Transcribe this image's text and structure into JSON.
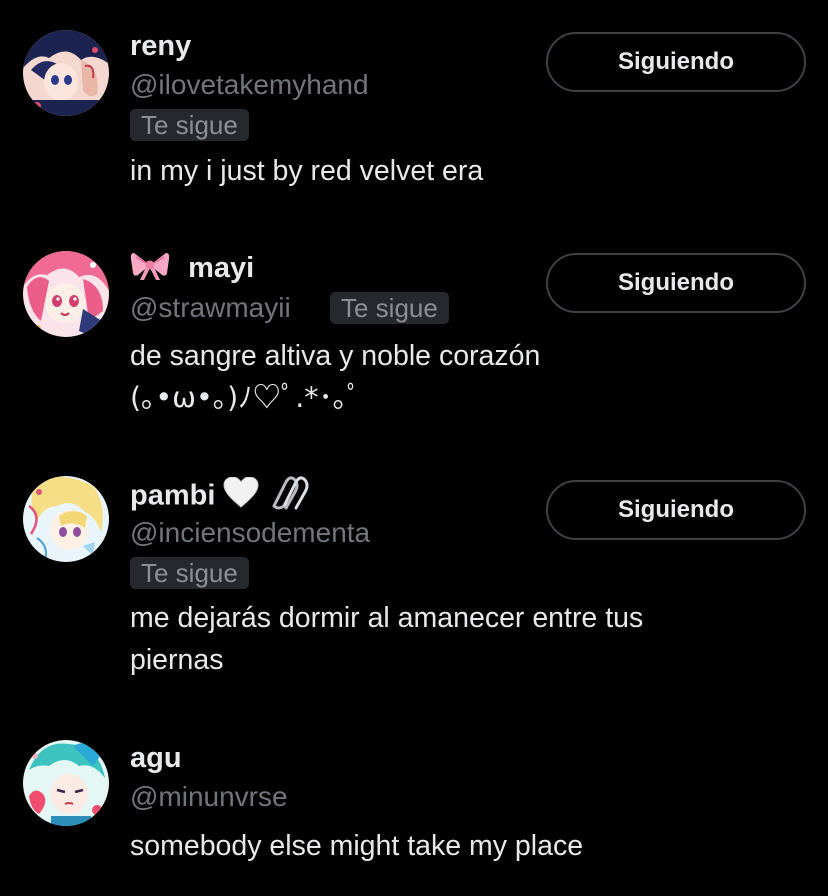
{
  "users": [
    {
      "display_name": "reny",
      "handle": "@ilovetakemyhand",
      "follows_you_label": "Te sigue",
      "bio": [
        "in my i just by red velvet era"
      ],
      "follow_button_label": "Siguiendo",
      "avatar_icon": "anime-avatar-dark-blue"
    },
    {
      "name_prefix_emoji": "🎀",
      "display_name": "mayi",
      "handle": "@strawmayii",
      "follows_you_label": "Te sigue",
      "bio": [
        "de sangre altiva y noble corazón",
        "(｡•ω•｡)ﾉ♡ﾟ.*･｡ﾟ"
      ],
      "follow_button_label": "Siguiendo",
      "avatar_icon": "anime-avatar-pink-hair"
    },
    {
      "display_name": "pambi",
      "name_suffix_emoji": [
        "🤍",
        "🖇"
      ],
      "handle": "@inciensodementa",
      "follows_you_label": "Te sigue",
      "bio": [
        "me dejarás dormir al amanecer entre tus",
        "piernas"
      ],
      "follow_button_label": "Siguiendo",
      "avatar_icon": "anime-avatar-blonde"
    },
    {
      "display_name": "agu",
      "handle": "@minunvrse",
      "bio": [
        "somebody else might take my place"
      ],
      "avatar_icon": "anime-avatar-teal-hair"
    }
  ],
  "colors": {
    "background": "#000000",
    "primary_text": "#e7e9ea",
    "secondary_text": "#71767b",
    "badge_bg": "#25282c",
    "button_border": "#3e4144"
  }
}
